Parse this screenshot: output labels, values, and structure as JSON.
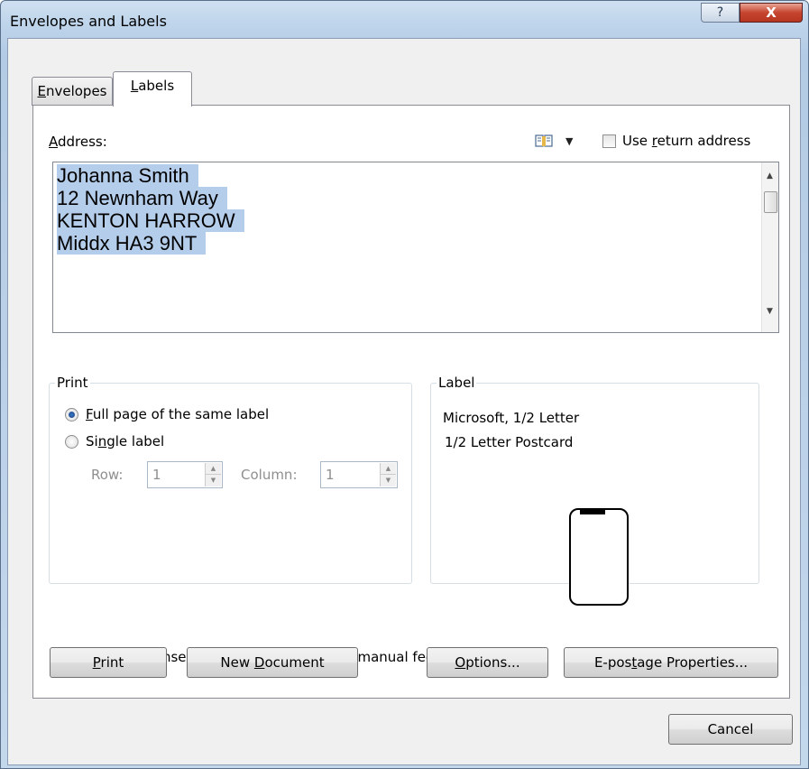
{
  "window": {
    "title": "Envelopes and Labels",
    "help_glyph": "?",
    "close_glyph": "X"
  },
  "tabs": [
    {
      "label": "Envelopes",
      "hotkey": "E",
      "rest": "nvelopes"
    },
    {
      "label": "Labels",
      "hotkey": "L",
      "rest": "abels"
    }
  ],
  "address": {
    "label_hotkey": "A",
    "label_rest": "ddress:",
    "lines": [
      "Johanna Smith",
      "12 Newnham Way",
      "KENTON HARROW",
      "Middx HA3 9NT"
    ],
    "use_return_address": {
      "pre": "Use ",
      "hotkey": "r",
      "post": "eturn address",
      "checked": false
    }
  },
  "print_group": {
    "title": "Print",
    "full_page": {
      "hotkey": "F",
      "rest": "ull page of the same label",
      "selected": true
    },
    "single_label": {
      "pre": "Si",
      "hotkey": "n",
      "post": "gle label",
      "selected": false
    },
    "row": {
      "label": "Row:",
      "value": "1"
    },
    "column": {
      "label": "Column:",
      "value": "1"
    }
  },
  "label_group": {
    "title": "Label",
    "line1": "Microsoft, 1/2 Letter",
    "line2": "1/2 Letter Postcard"
  },
  "hint": "Before printing, insert labels in your printer's manual feeder.",
  "buttons": {
    "print": {
      "hotkey": "P",
      "rest": "rint"
    },
    "new_document": {
      "pre": "New ",
      "hotkey": "D",
      "post": "ocument"
    },
    "options": {
      "hotkey": "O",
      "rest": "ptions..."
    },
    "epostage": {
      "pre": "E-pos",
      "hotkey": "t",
      "post": "age Properties..."
    },
    "cancel": "Cancel"
  },
  "colors": {
    "selection": "#b4cdea",
    "close_button": "#c6452f"
  }
}
